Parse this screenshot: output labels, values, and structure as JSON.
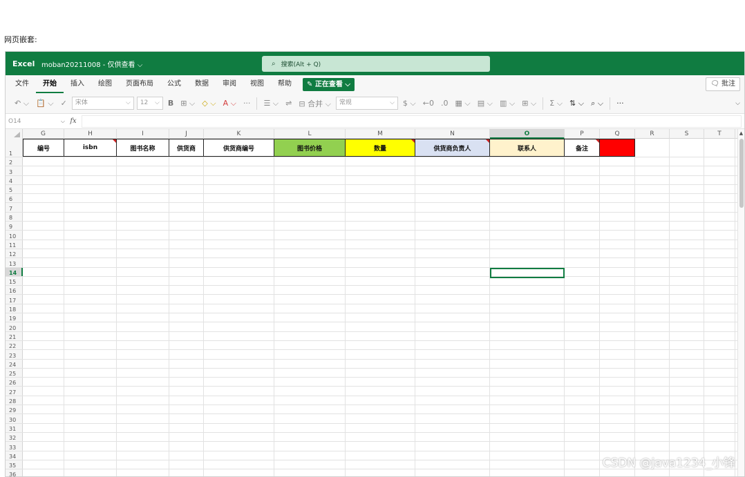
{
  "page": {
    "caption": "网页嵌套:"
  },
  "titlebar": {
    "app": "Excel",
    "file": "moban20211008 - 仅供查看 ⌵",
    "search_placeholder": "搜索(Alt + Q)"
  },
  "tabs": {
    "items": [
      {
        "label": "文件",
        "active": false
      },
      {
        "label": "开始",
        "active": true
      },
      {
        "label": "插入",
        "active": false
      },
      {
        "label": "绘图",
        "active": false
      },
      {
        "label": "页面布局",
        "active": false
      },
      {
        "label": "公式",
        "active": false
      },
      {
        "label": "数据",
        "active": false
      },
      {
        "label": "审阅",
        "active": false
      },
      {
        "label": "视图",
        "active": false
      },
      {
        "label": "帮助",
        "active": false
      }
    ],
    "viewing_label": "✎ 正在查看 ⌵",
    "comments_label": "🗨 批注"
  },
  "toolbar": {
    "undo": "↶ ⌵",
    "paste": "📋 ⌵",
    "format_painter": "✓",
    "font_name": "宋体",
    "font_size": "12",
    "bold": "B",
    "borders": "⊞ ⌵",
    "fill": "◇ ⌵",
    "font_color": "A ⌵",
    "more_font": "···",
    "align": "☰ ⌵",
    "wrap": "⇌",
    "merge": "⊟ 合并 ⌵",
    "number_format": "常规",
    "currency": "$ ⌵",
    "inc_decimal": "←0",
    "dec_decimal": ".0",
    "cond_format": "▦ ⌵",
    "format_table": "▤ ⌵",
    "cell_styles": "▥ ⌵",
    "insert_cells": "⊞ ⌵",
    "sum": "Σ ⌵",
    "sort": "⇅ ⌵",
    "find": "⌕ ⌵",
    "more": "···",
    "ribbon_toggle": "⌵"
  },
  "formula_bar": {
    "name_box": "O14",
    "fx": "fx",
    "value": ""
  },
  "grid": {
    "columns": [
      "G",
      "H",
      "I",
      "J",
      "K",
      "L",
      "M",
      "N",
      "O",
      "P",
      "Q",
      "R",
      "S",
      "T"
    ],
    "selected_column": "O",
    "selected_row": 14,
    "header_row": [
      {
        "col": "G",
        "text": "编号",
        "bg": "#ffffff",
        "comment": false
      },
      {
        "col": "H",
        "text": "isbn",
        "bg": "#ffffff",
        "comment": true
      },
      {
        "col": "I",
        "text": "图书名称",
        "bg": "#ffffff",
        "comment": false
      },
      {
        "col": "J",
        "text": "供货商",
        "bg": "#ffffff",
        "comment": false
      },
      {
        "col": "K",
        "text": "供货商编号",
        "bg": "#ffffff",
        "comment": false
      },
      {
        "col": "L",
        "text": "图书价格",
        "bg": "#92d050",
        "comment": false
      },
      {
        "col": "M",
        "text": "数量",
        "bg": "#ffff00",
        "comment": true
      },
      {
        "col": "N",
        "text": "供货商负责人",
        "bg": "#d9e1f2",
        "comment": true
      },
      {
        "col": "O",
        "text": "联系人",
        "bg": "#fff2cc",
        "comment": false
      },
      {
        "col": "P",
        "text": "备注",
        "bg": "#ffffff",
        "comment": true
      },
      {
        "col": "Q",
        "text": "",
        "bg": "#ff0000",
        "comment": false
      }
    ],
    "row_numbers": [
      "1",
      "2",
      "3",
      "4",
      "5",
      "6",
      "7",
      "8",
      "9",
      "10",
      "11",
      "12",
      "13",
      "14",
      "15",
      "16",
      "17",
      "18",
      "19",
      "20",
      "21",
      "22",
      "23",
      "24",
      "25",
      "26",
      "27",
      "28",
      "29",
      "30",
      "31",
      "32",
      "33",
      "34",
      "35",
      "36"
    ]
  },
  "watermark": "CSDN @java1234_小锋",
  "colors": {
    "brand": "#107c41",
    "search_bg": "#c8e6d4"
  }
}
